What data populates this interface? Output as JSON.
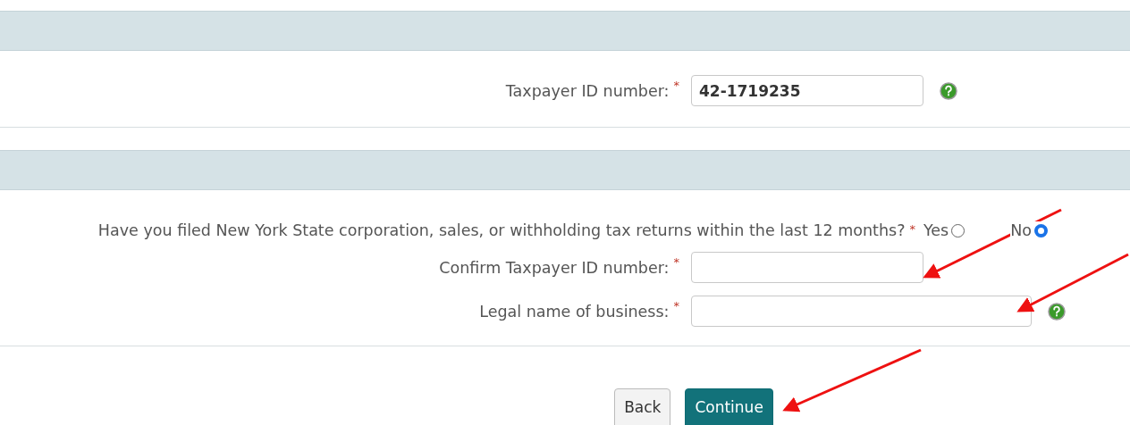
{
  "sections": [
    {
      "kind": "taxpayer",
      "fields": [
        {
          "label": "Taxpayer ID number:",
          "required_mark": "*",
          "value": "42-1719235",
          "wide": false,
          "help": true
        }
      ]
    },
    {
      "kind": "questions",
      "question": {
        "text": "Have you filed New York State corporation, sales, or withholding tax returns within the last 12 months?",
        "required_mark": "*",
        "options": [
          {
            "label": "Yes",
            "selected": false
          },
          {
            "label": "No",
            "selected": true
          }
        ]
      },
      "fields": [
        {
          "label": "Confirm Taxpayer ID number:",
          "required_mark": "*",
          "wide": false,
          "help": false
        },
        {
          "label": "Legal name of business:",
          "required_mark": "*",
          "wide": true,
          "help": true
        }
      ]
    }
  ],
  "buttons": [
    {
      "label": "Back",
      "kind": "secondary"
    },
    {
      "label": "Continue",
      "kind": "primary"
    }
  ],
  "annotations": [
    {
      "kind": "arrow"
    },
    {
      "kind": "arrow"
    },
    {
      "kind": "arrow"
    }
  ]
}
